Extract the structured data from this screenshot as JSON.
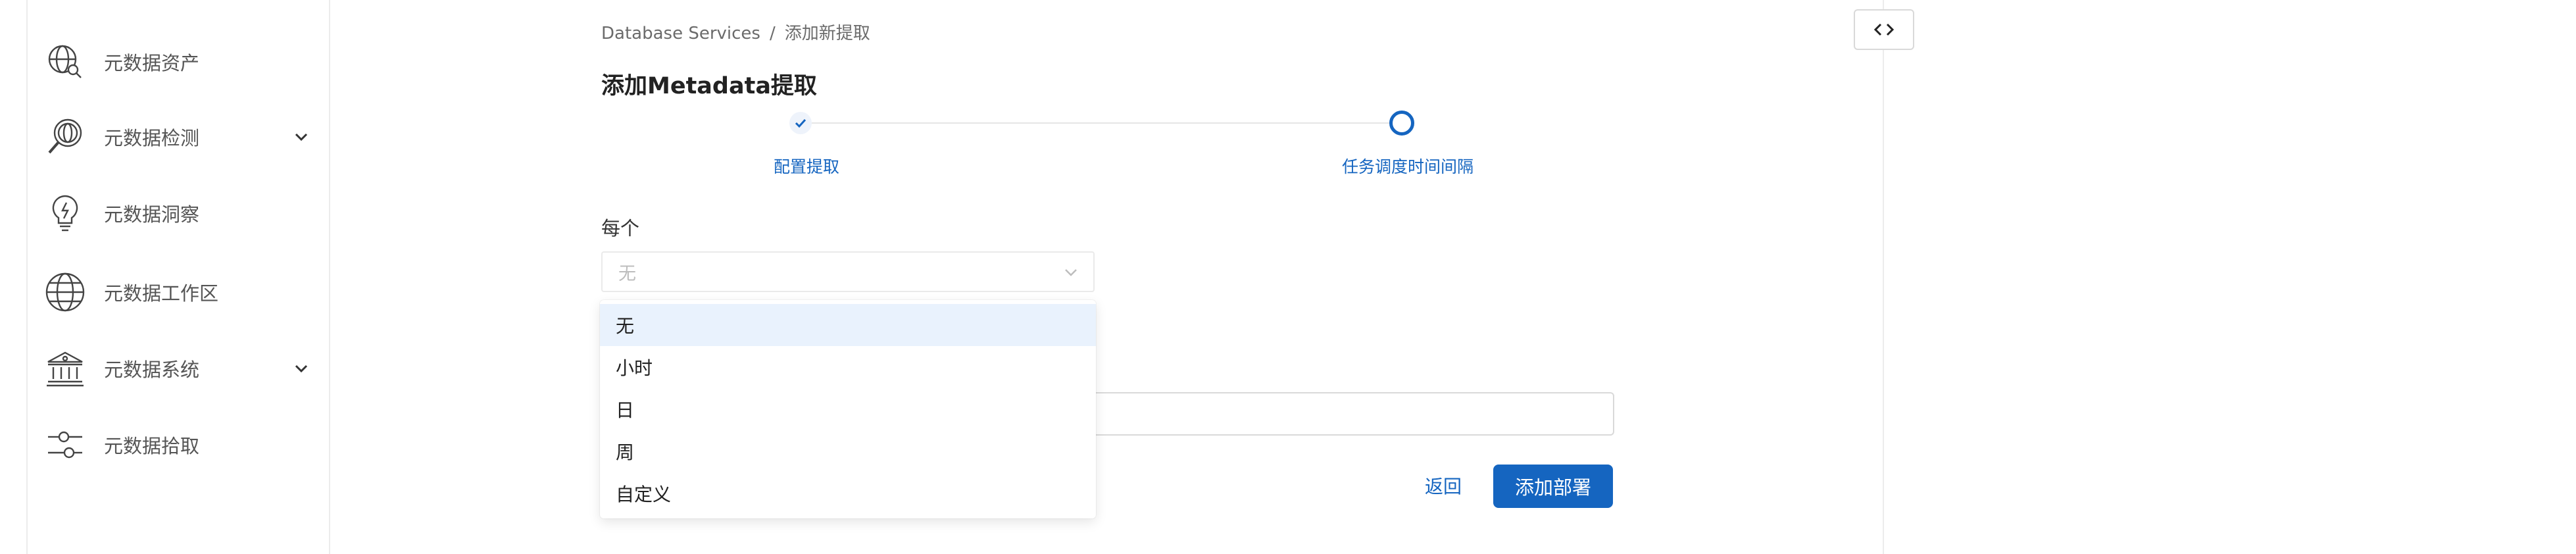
{
  "sidebar": {
    "items": [
      {
        "label": "元数据资产",
        "icon": "globe-search-icon",
        "expandable": false
      },
      {
        "label": "元数据检测",
        "icon": "magnifier-globe-icon",
        "expandable": true
      },
      {
        "label": "元数据洞察",
        "icon": "lightbulb-icon",
        "expandable": false
      },
      {
        "label": "元数据工作区",
        "icon": "globe-icon",
        "expandable": false
      },
      {
        "label": "元数据系统",
        "icon": "bank-icon",
        "expandable": true
      },
      {
        "label": "元数据拾取",
        "icon": "sliders-icon",
        "expandable": false
      }
    ]
  },
  "breadcrumb": {
    "items": [
      "Database Services",
      "添加新提取"
    ],
    "separator": "/"
  },
  "page": {
    "title": "添加Metadata提取"
  },
  "stepper": {
    "steps": [
      {
        "label": "配置提取",
        "state": "completed"
      },
      {
        "label": "任务调度时间间隔",
        "state": "active"
      }
    ]
  },
  "schedule": {
    "label": "每个",
    "selected": "无",
    "options": [
      "无",
      "小时",
      "日",
      "周",
      "自定义"
    ]
  },
  "actions": {
    "back": "返回",
    "deploy": "添加部署"
  },
  "colors": {
    "accent": "#1565c0",
    "selected_option_bg": "#e9f2fd"
  }
}
